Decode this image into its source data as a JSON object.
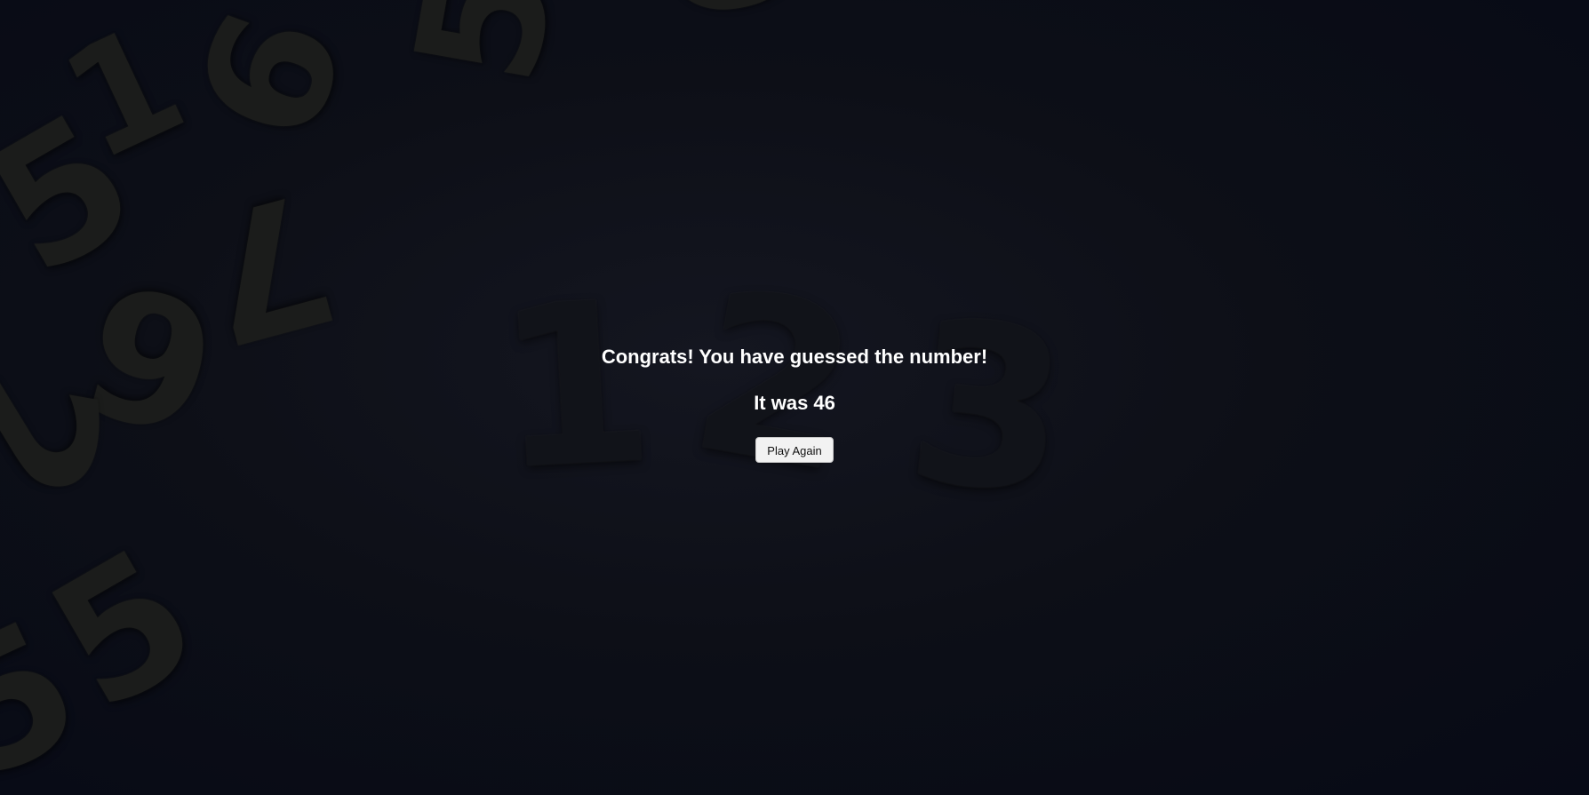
{
  "game": {
    "message": "Congrats! You have guessed the number!",
    "result_prefix": "It was",
    "guessed_number": "46",
    "play_again_label": "Play Again"
  },
  "background": {
    "center_digits": [
      "1",
      "2",
      "3"
    ],
    "corner_digits": [
      "1",
      "5",
      "6",
      "5",
      "7",
      "6",
      "2",
      "6",
      "5",
      "5"
    ]
  }
}
